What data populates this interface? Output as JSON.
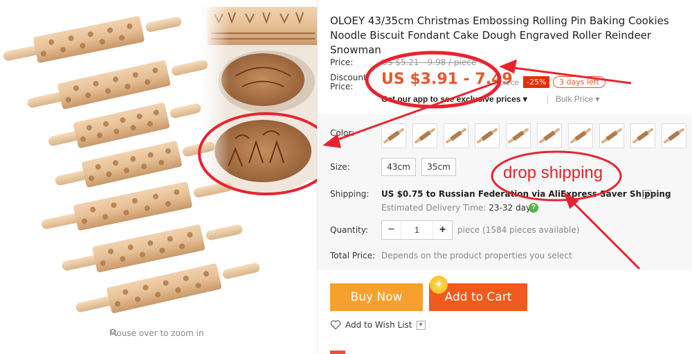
{
  "gallery": {
    "zoom_hint": "Mouse over to zoom in",
    "rolling_pins": [
      "stars",
      "cats",
      "hearts",
      "reindeer",
      "animals",
      "christmas-trees",
      "gingerbread"
    ]
  },
  "product": {
    "title": "OLOEY 43/35cm Christmas Embossing Rolling Pin Baking Cookies Noodle Biscuit Fondant Cake Dough Engraved Roller Reindeer Snowman",
    "price_label": "Price:",
    "price_old": "US $5.21 - 9.98 / piece",
    "discount_label_1": "Discount",
    "discount_label_2": "Price:",
    "discount_price": "US $3.91 - 7.49",
    "unit": "/ piece",
    "discount_badge": "-25%",
    "days_left": "3 days left",
    "exclusive": "Get our app to see exclusive prices ▾",
    "bulk_price": "Bulk Price ▾",
    "color_label": "Color:",
    "size_label": "Size:",
    "sizes": [
      "43cm",
      "35cm"
    ],
    "shipping_label": "Shipping:",
    "shipping_text": "US $0.75 to Russian Federation via AliExpress Saver Shipping",
    "delivery_label": "Estimated Delivery Time: ",
    "delivery_days": "23-32 days",
    "quantity_label": "Quantity:",
    "quantity_value": "1",
    "quantity_available": "piece (1584 pieces available)",
    "total_label": "Total Price:",
    "total_text": "Depends on the product properties you select",
    "buy_now": "Buy Now",
    "add_to_cart": "Add to Cart",
    "wishlist": "Add to Wish List"
  },
  "annotation": {
    "drop_shipping": "drop shipping",
    "circle_color": "#e8232f"
  },
  "colors": {
    "price": "#e8572c",
    "buy_now": "#f7a02d",
    "add_to_cart": "#f05a1c",
    "badge": "#e62e04"
  }
}
